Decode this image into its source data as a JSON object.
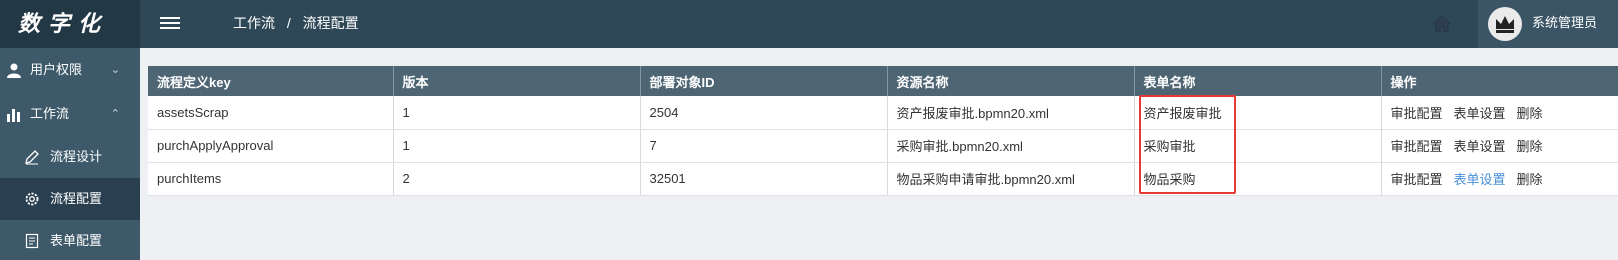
{
  "app": {
    "logo_text": "数字化"
  },
  "header": {
    "breadcrumb": [
      "工作流",
      "流程配置"
    ],
    "user_name": "系统管理员"
  },
  "sidebar": {
    "items": [
      {
        "label": "用户权限",
        "icon": "user-icon",
        "expanded": false
      },
      {
        "label": "工作流",
        "icon": "bar-chart-icon",
        "expanded": true,
        "children": [
          {
            "label": "流程设计",
            "icon": "pen-icon"
          },
          {
            "label": "流程配置",
            "icon": "gear-icon",
            "active": true
          },
          {
            "label": "表单配置",
            "icon": "document-icon"
          }
        ]
      }
    ]
  },
  "table": {
    "headers": [
      "流程定义key",
      "版本",
      "部署对象ID",
      "资源名称",
      "表单名称",
      "操作"
    ],
    "rows": [
      {
        "key": "assetsScrap",
        "version": "1",
        "deploy_id": "2504",
        "resource": "资产报废审批.bpmn20.xml",
        "form": "资产报废审批"
      },
      {
        "key": "purchApplyApproval",
        "version": "1",
        "deploy_id": "7",
        "resource": "采购审批.bpmn20.xml",
        "form": "采购审批"
      },
      {
        "key": "purchItems",
        "version": "2",
        "deploy_id": "32501",
        "resource": "物品采购申请审批.bpmn20.xml",
        "form": "物品采购"
      }
    ],
    "actions": [
      "审批配置",
      "表单设置",
      "删除"
    ]
  },
  "colors": {
    "topbar": "#2f4858",
    "sidebar": "#3e5a6a",
    "table_header": "#4e6574",
    "highlight_box": "#e53935",
    "link_hover": "#4a90d9"
  }
}
